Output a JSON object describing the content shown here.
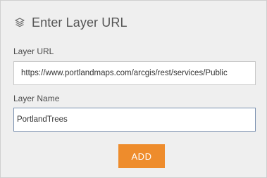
{
  "dialog": {
    "title": "Enter Layer URL",
    "icon": "layers-icon"
  },
  "layer_url": {
    "label": "Layer URL",
    "value": "https://www.portlandmaps.com/arcgis/rest/services/Public"
  },
  "layer_name": {
    "label": "Layer Name",
    "value": "PortlandTrees"
  },
  "actions": {
    "add_label": "ADD"
  },
  "colors": {
    "add_button": "#ee8c2c",
    "panel_background": "#efefef",
    "focused_border": "#7a90b0"
  }
}
